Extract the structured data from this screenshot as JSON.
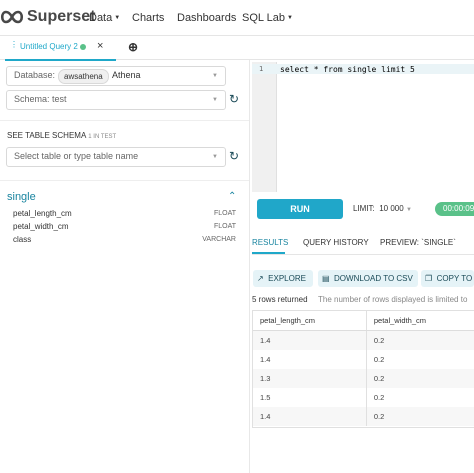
{
  "navbar": {
    "brand": "Superset",
    "items": [
      {
        "label": "Data",
        "dropdown": true
      },
      {
        "label": "Charts",
        "dropdown": false
      },
      {
        "label": "Dashboards",
        "dropdown": false
      },
      {
        "label": "SQL Lab",
        "dropdown": true
      }
    ]
  },
  "query_tab": {
    "label": "Untitled Query 2",
    "status_color": "#5ac189",
    "close": "×",
    "add": "⊕"
  },
  "left_panel": {
    "database_label": "Database:",
    "database_pill": "awsathena",
    "database_value": "Athena",
    "schema_text": "Schema: test",
    "schema_heading": "SEE TABLE SCHEMA",
    "schema_count": "1 IN TEST",
    "table_placeholder": "Select table or type table name",
    "table_name": "single",
    "columns": [
      {
        "name": "petal_length_cm",
        "type": "FLOAT"
      },
      {
        "name": "petal_width_cm",
        "type": "FLOAT"
      },
      {
        "name": "class",
        "type": "VARCHAR"
      }
    ]
  },
  "editor": {
    "line_number": "1",
    "code": "select * from single limit 5"
  },
  "controls": {
    "run_label": "RUN",
    "limit_label": "LIMIT:",
    "limit_value": "10 000",
    "timer": "00:00:09"
  },
  "results": {
    "tabs": [
      "RESULTS",
      "QUERY HISTORY",
      "PREVIEW: `SINGLE`"
    ],
    "buttons": [
      "EXPLORE",
      "DOWNLOAD TO CSV",
      "COPY TO"
    ],
    "rows_returned": "5 rows returned",
    "note": "The number of rows displayed is limited to",
    "columns": [
      "petal_length_cm",
      "petal_width_cm"
    ],
    "rows": [
      [
        "1.4",
        "0.2"
      ],
      [
        "1.4",
        "0.2"
      ],
      [
        "1.3",
        "0.2"
      ],
      [
        "1.5",
        "0.2"
      ],
      [
        "1.4",
        "0.2"
      ]
    ]
  },
  "colors": {
    "accent": "#20a7c9",
    "success": "#5ac189"
  }
}
